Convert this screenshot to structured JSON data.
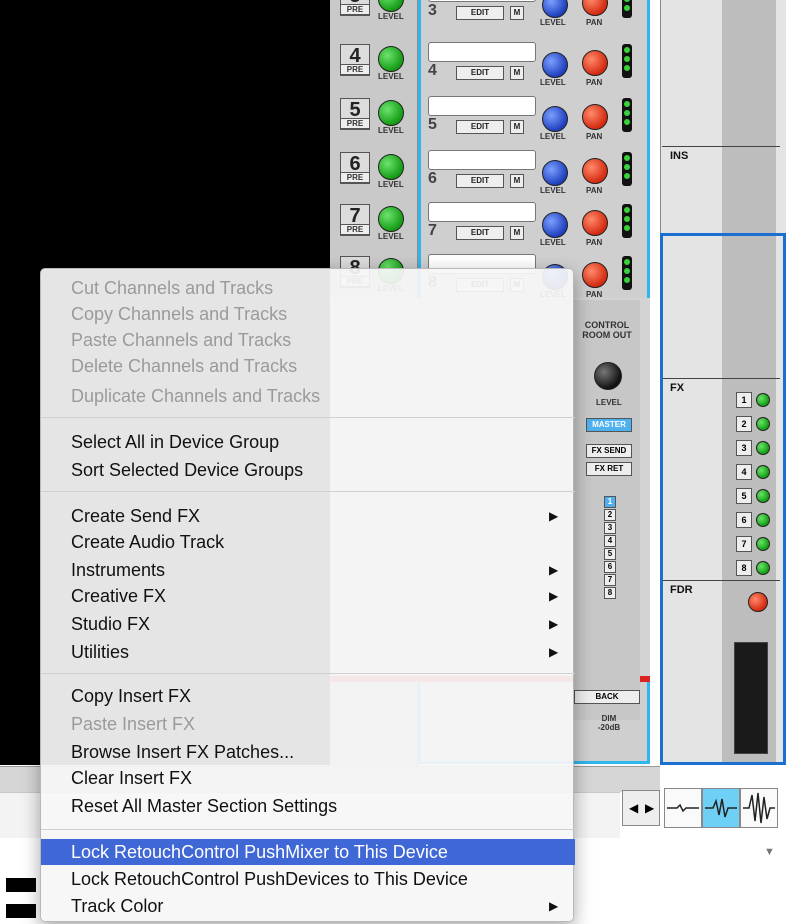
{
  "mixer": {
    "rows": [
      {
        "num": "3",
        "pre": "PRE",
        "level": "LEVEL",
        "edit": "EDIT",
        "m": "M",
        "level2": "LEVEL",
        "pan": "PAN"
      },
      {
        "num": "4",
        "pre": "PRE",
        "level": "LEVEL",
        "edit": "EDIT",
        "m": "M",
        "level2": "LEVEL",
        "pan": "PAN"
      },
      {
        "num": "5",
        "pre": "PRE",
        "level": "LEVEL",
        "edit": "EDIT",
        "m": "M",
        "level2": "LEVEL",
        "pan": "PAN"
      },
      {
        "num": "6",
        "pre": "PRE",
        "level": "LEVEL",
        "edit": "EDIT",
        "m": "M",
        "level2": "LEVEL",
        "pan": "PAN"
      },
      {
        "num": "7",
        "pre": "PRE",
        "level": "LEVEL",
        "edit": "EDIT",
        "m": "M",
        "level2": "LEVEL",
        "pan": "PAN"
      },
      {
        "num": "8",
        "pre": "PRE",
        "level": "LEVEL",
        "edit": "EDIT",
        "m": "M",
        "level2": "LEVEL",
        "pan": "PAN"
      }
    ],
    "control_room": {
      "title": "CONTROL ROOM OUT",
      "level": "LEVEL",
      "master": "MASTER",
      "fx_send": "FX SEND",
      "fx_ret": "FX RET",
      "numbers": [
        "1",
        "2",
        "3",
        "4",
        "5",
        "6",
        "7",
        "8"
      ],
      "back": "BACK",
      "dim": "DIM -20dB"
    }
  },
  "rack": {
    "labels": {
      "ins": "INS",
      "fx": "FX",
      "fdr": "FDR"
    },
    "fx_buttons": [
      "1",
      "2",
      "3",
      "4",
      "5",
      "6",
      "7",
      "8"
    ]
  },
  "context_menu": {
    "group1": [
      {
        "label": "Cut Channels and Tracks",
        "enabled": false
      },
      {
        "label": "Copy Channels and Tracks",
        "enabled": false
      },
      {
        "label": "Paste Channels and Tracks",
        "enabled": false
      },
      {
        "label": "Delete Channels and Tracks",
        "enabled": false
      },
      {
        "label": "Duplicate Channels and Tracks",
        "enabled": false
      }
    ],
    "group2": [
      {
        "label": "Select All in Device Group",
        "enabled": true
      },
      {
        "label": "Sort Selected Device Groups",
        "enabled": true
      }
    ],
    "group3": [
      {
        "label": "Create Send FX",
        "enabled": true,
        "submenu": true
      },
      {
        "label": "Create Audio Track",
        "enabled": true,
        "submenu": false
      },
      {
        "label": "Instruments",
        "enabled": true,
        "submenu": true
      },
      {
        "label": "Creative FX",
        "enabled": true,
        "submenu": true
      },
      {
        "label": "Studio FX",
        "enabled": true,
        "submenu": true
      },
      {
        "label": "Utilities",
        "enabled": true,
        "submenu": true
      }
    ],
    "group4": [
      {
        "label": "Copy Insert FX",
        "enabled": true
      },
      {
        "label": "Paste Insert FX",
        "enabled": false
      },
      {
        "label": "Browse Insert FX Patches...",
        "enabled": true
      },
      {
        "label": "Clear Insert FX",
        "enabled": true
      },
      {
        "label": "Reset All Master Section Settings",
        "enabled": true
      }
    ],
    "group5": [
      {
        "label": "Lock RetouchControl PushMixer to This Device",
        "enabled": true,
        "highlighted": true
      },
      {
        "label": "Lock RetouchControl PushDevices to This Device",
        "enabled": true
      },
      {
        "label": "Track Color",
        "enabled": true,
        "submenu": true
      }
    ],
    "submenu_glyph": "▶"
  },
  "colors": {
    "highlight": "#3f67d6",
    "channel_frame": "#2fb6ec",
    "rack_frame": "#1a6fcf"
  }
}
